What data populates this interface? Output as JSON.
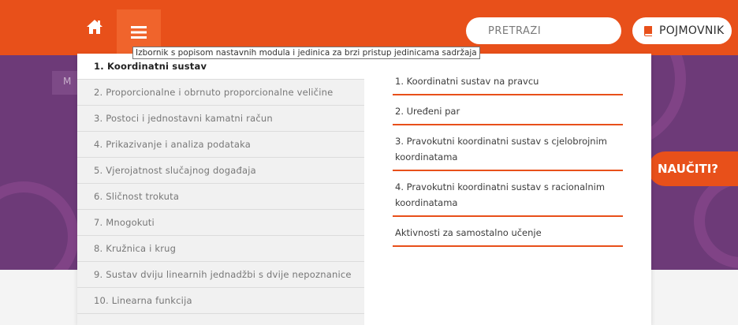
{
  "topbar": {
    "home_icon": "home-icon",
    "menu_icon": "hamburger-menu-icon",
    "search_placeholder": "PRETRAŽI",
    "glossary_icon": "book-icon",
    "glossary_label": "POJMOVNIK",
    "accent_color": "#e8501a"
  },
  "hero": {
    "tab_label": "M",
    "cta_label": "NAUČITI?",
    "background_color": "#6d3a78"
  },
  "tooltip": "Izbornik s popisom nastavnih modula i jedinica za brzi pristup jedinicama sadržaja",
  "modules": [
    "1. Koordinatni sustav",
    "2. Proporcionalne i obrnuto proporcionalne veličine",
    "3. Postoci i jednostavni kamatni račun",
    "4. Prikazivanje i analiza podataka",
    "5. Vjerojatnost slučajnog događaja",
    "6. Sličnost trokuta",
    "7. Mnogokuti",
    "8. Kružnica i krug",
    "9. Sustav dviju linearnih jednadžbi s dvije nepoznanice",
    "10. Linearna funkcija"
  ],
  "units": [
    "1. Koordinatni sustav na pravcu",
    "2. Uređeni par",
    "3. Pravokutni koordinatni sustav s cjelobrojnim koordinatama",
    "4. Pravokutni koordinatni sustav s racionalnim koordinatama",
    "Aktivnosti za samostalno učenje"
  ]
}
